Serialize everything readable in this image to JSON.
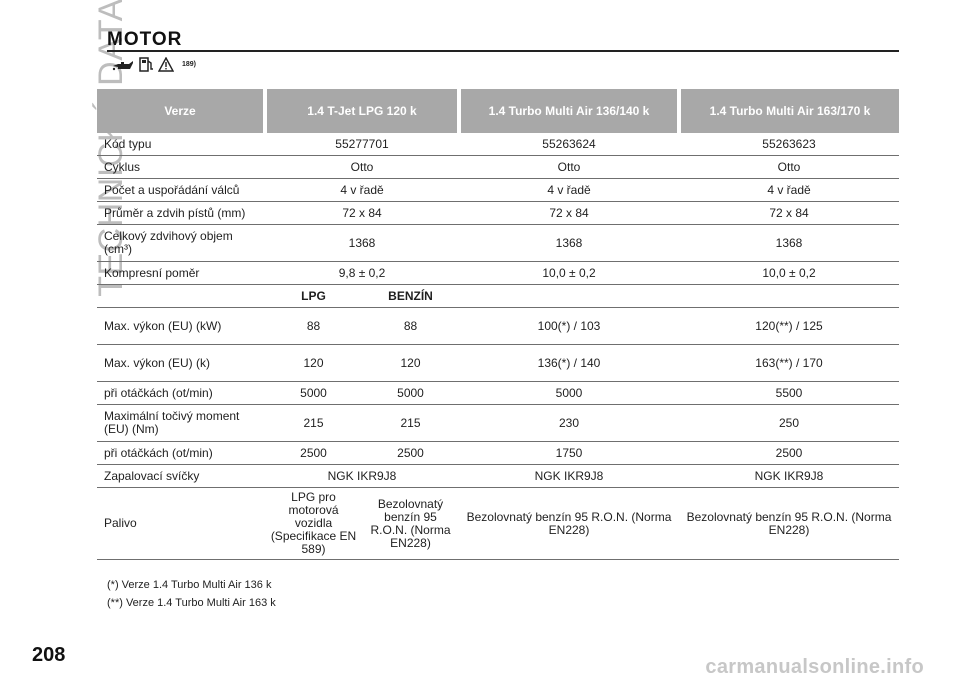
{
  "side_title": "TECHNICKÁ DATA",
  "section_title": "MOTOR",
  "icon_ref": "189)",
  "table": {
    "headers": [
      "Verze",
      "1.4 T-Jet LPG 120 k",
      "1.4 Turbo Multi Air 136/140 k",
      "1.4 Turbo Multi Air 163/170 k"
    ],
    "rows_a": [
      {
        "label": "Kód typu",
        "v1": "55277701",
        "v2": "55263624",
        "v3": "55263623"
      },
      {
        "label": "Cyklus",
        "v1": "Otto",
        "v2": "Otto",
        "v3": "Otto"
      },
      {
        "label": "Počet a uspořádání válců",
        "v1": "4 v řadě",
        "v2": "4 v řadě",
        "v3": "4 v řadě"
      },
      {
        "label": "Průměr a zdvih pístů (mm)",
        "v1": "72 x 84",
        "v2": "72 x 84",
        "v3": "72 x 84"
      },
      {
        "label": "Celkový zdvihový objem (cm³)",
        "v1": "1368",
        "v2": "1368",
        "v3": "1368"
      },
      {
        "label": "Kompresní poměr",
        "v1": "9,8 ± 0,2",
        "v2": "10,0 ± 0,2",
        "v3": "10,0 ± 0,2"
      }
    ],
    "fuel_labels": {
      "lpg": "LPG",
      "petrol": "BENZÍN"
    },
    "rows_b": [
      {
        "label": "Max. výkon (EU) (kW)",
        "lpg": "88",
        "petrol": "88",
        "v2": "100(*) / 103",
        "v3": "120(**) / 125"
      },
      {
        "label": "Max. výkon (EU) (k)",
        "lpg": "120",
        "petrol": "120",
        "v2": "136(*) / 140",
        "v3": "163(**) / 170"
      },
      {
        "label": "při otáčkách (ot/min)",
        "lpg": "5000",
        "petrol": "5000",
        "v2": "5000",
        "v3": "5500"
      },
      {
        "label": "Maximální točivý moment (EU) (Nm)",
        "lpg": "215",
        "petrol": "215",
        "v2": "230",
        "v3": "250"
      },
      {
        "label": "při otáčkách (ot/min)",
        "lpg": "2500",
        "petrol": "2500",
        "v2": "1750",
        "v3": "2500"
      }
    ],
    "spark": {
      "label": "Zapalovací svíčky",
      "v1": "NGK IKR9J8",
      "v2": "NGK IKR9J8",
      "v3": "NGK IKR9J8"
    },
    "fuel": {
      "label": "Palivo",
      "lpg": "LPG pro motorová vozidla (Specifikace EN 589)",
      "petrol": "Bezolovnatý benzín 95 R.O.N. (Norma EN228)",
      "v2": "Bezolovnatý benzín 95 R.O.N. (Norma EN228)",
      "v3": "Bezolovnatý benzín 95 R.O.N. (Norma EN228)"
    }
  },
  "footnotes": [
    "(*) Verze 1.4 Turbo Multi Air 136 k",
    "(**) Verze 1.4 Turbo Multi Air 163 k"
  ],
  "page_number": "208",
  "watermark": "carmanualsonline.info"
}
